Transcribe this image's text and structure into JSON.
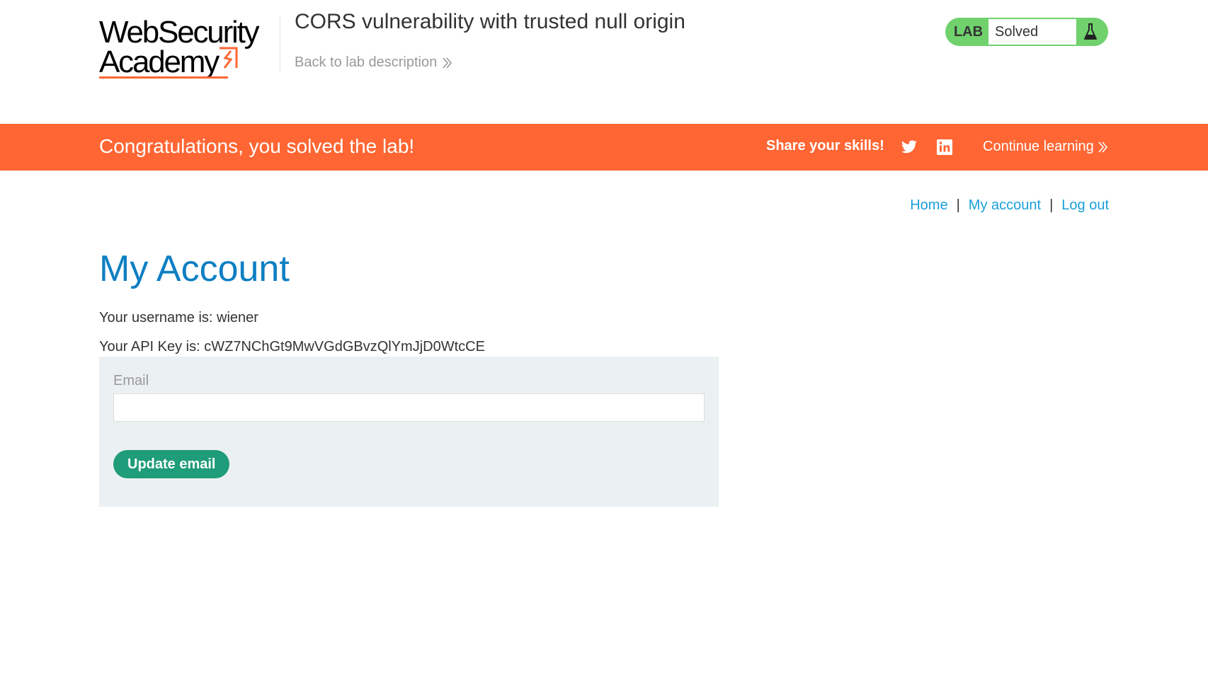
{
  "header": {
    "logo": {
      "line1": "WebSecurity",
      "line2": "Academy"
    },
    "lab_title": "CORS vulnerability with trusted null origin",
    "back_link": "Back to lab description",
    "status": {
      "badge": "LAB",
      "state": "Solved"
    }
  },
  "banner": {
    "message": "Congratulations, you solved the lab!",
    "share_label": "Share your skills!",
    "continue_label": "Continue learning"
  },
  "nav": {
    "home": "Home",
    "separator": "|",
    "my_account": "My account",
    "log_out": "Log out"
  },
  "account": {
    "heading": "My Account",
    "username_line": "Your username is: wiener",
    "api_key_line": "Your API Key is: cWZ7NChGt9MwVGdGBvzQlYmJjD0WtcCE"
  },
  "form": {
    "email_label": "Email",
    "email_value": "",
    "submit_label": "Update email"
  },
  "colors": {
    "brand_orange": "#ff6633",
    "heading_blue": "#0e7fc3",
    "link_blue": "#1a9fd9",
    "status_green": "#70d16d",
    "button_green": "#1f9c79",
    "panel_gray": "#ebf0f2"
  },
  "icons": {
    "chevron": "double-chevron-right-icon",
    "flask": "flask-icon",
    "twitter": "twitter-icon",
    "linkedin": "linkedin-icon"
  }
}
